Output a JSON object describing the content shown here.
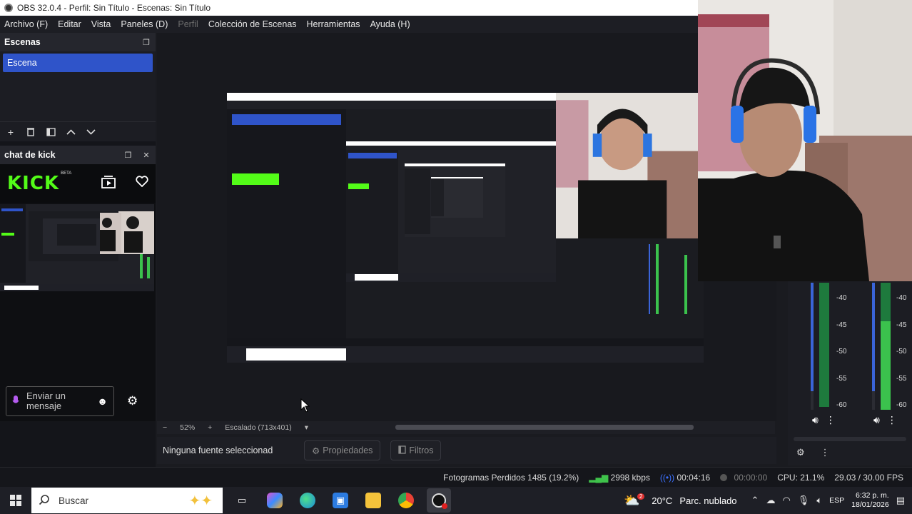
{
  "window": {
    "title": "OBS 32.0.4 - Perfil: Sin Título - Escenas: Sin Título"
  },
  "menu": {
    "items": [
      {
        "label": "Archivo (F)",
        "enabled": true
      },
      {
        "label": "Editar",
        "enabled": true
      },
      {
        "label": "Vista",
        "enabled": true
      },
      {
        "label": "Paneles (D)",
        "enabled": true
      },
      {
        "label": "Perfil",
        "enabled": false
      },
      {
        "label": "Colección de Escenas",
        "enabled": true
      },
      {
        "label": "Herramientas",
        "enabled": true
      },
      {
        "label": "Ayuda (H)",
        "enabled": true
      }
    ]
  },
  "scenes": {
    "header": "Escenas",
    "items": [
      "Escena"
    ],
    "selected_color": "#2f54c9"
  },
  "chat_dock": {
    "header": "chat de kick",
    "brand": "KICK",
    "brand_badge": "BETA",
    "brand_color": "#53fc18",
    "input_placeholder": "Enviar un mensaje"
  },
  "preview": {
    "zoom": "52%",
    "scale_label": "Escalado (713x401)"
  },
  "source_bar": {
    "no_source": "Ninguna fuente seleccionad",
    "properties": "Propiedades",
    "filters": "Filtros"
  },
  "mixer": {
    "db_labels": [
      "-40",
      "-45",
      "-50",
      "-55",
      "-60"
    ],
    "channels": [
      {
        "level": 0.95,
        "peak": 0.95
      },
      {
        "level": 0.7,
        "peak": 0.7
      }
    ]
  },
  "status": {
    "dropped_frames": "Fotogramas Perdidos 1485 (19.2%)",
    "bitrate": "2998 kbps",
    "stream_time": "00:04:16",
    "rec_time": "00:00:00",
    "cpu": "CPU: 21.1%",
    "fps": "29.03 / 30.00 FPS",
    "accent": "#3fc24b"
  },
  "taskbar": {
    "search_placeholder": "Buscar",
    "weather": "20°C",
    "weather_desc": "Parc. nublado",
    "language": "ESP",
    "time": "6:32 p. m.",
    "date": "18/01/2026",
    "weather_badge": "2"
  }
}
